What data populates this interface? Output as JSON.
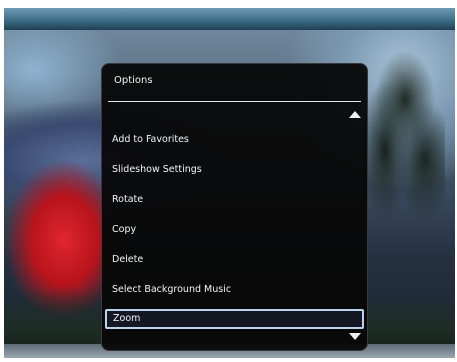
{
  "options_menu": {
    "title": "Options",
    "items": [
      {
        "label": "Add to Favorites",
        "selected": false
      },
      {
        "label": "Slideshow Settings",
        "selected": false
      },
      {
        "label": "Rotate",
        "selected": false
      },
      {
        "label": "Copy",
        "selected": false
      },
      {
        "label": "Delete",
        "selected": false
      },
      {
        "label": "Select Background Music",
        "selected": false
      },
      {
        "label": "Zoom",
        "selected": true
      }
    ],
    "scroll_up_icon": "triangle-up-icon",
    "scroll_down_icon": "triangle-down-icon"
  },
  "colors": {
    "panel_background": "#080808",
    "selection_border": "#bcd3ee",
    "text": "#f5f5f5"
  }
}
